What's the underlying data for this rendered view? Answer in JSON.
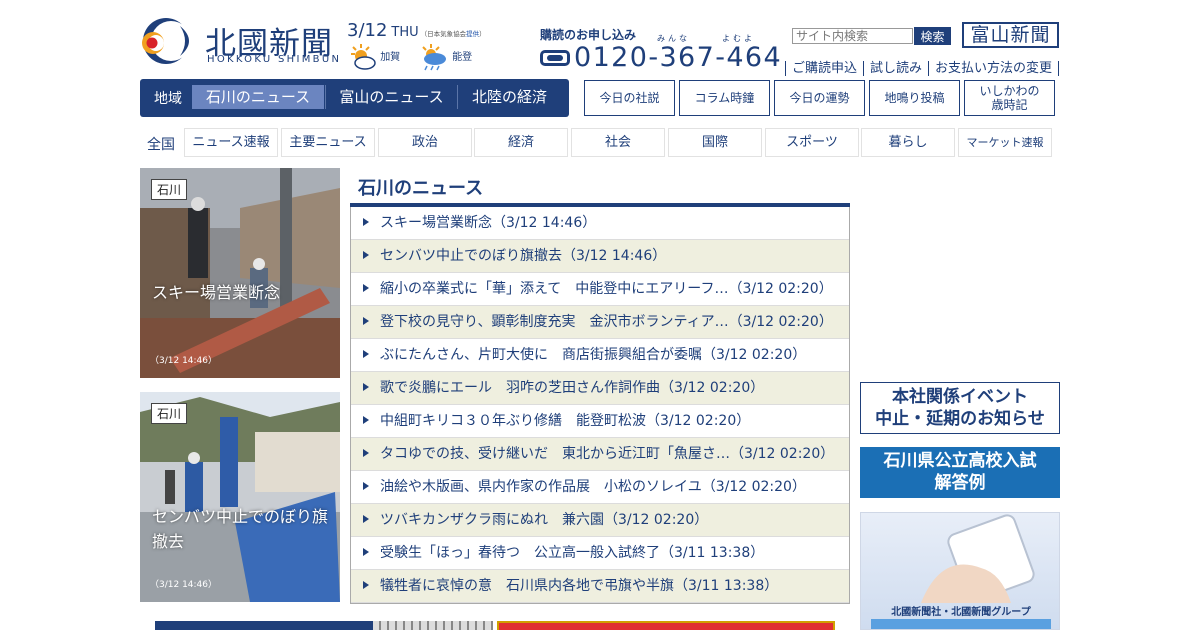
{
  "header": {
    "logo_title": "北國新聞",
    "logo_sub": "HOKKOKU SHIMBUN",
    "date": "3/12",
    "dow": "THU",
    "weather_source_prefix": "（日本気象協会",
    "weather_source_link": "提供",
    "weather_source_suffix": "）",
    "weather": [
      {
        "place": "加賀",
        "icon": "sun-cloud-icon"
      },
      {
        "place": "能登",
        "icon": "sun-rain-icon"
      }
    ],
    "subscribe_label": "購読のお申し込み",
    "phone_ruby_1": "みんな",
    "phone_ruby_2": "よむよ",
    "phone": "0120-367-464",
    "search_placeholder": "サイト内検索",
    "search_button": "検索",
    "toyama_logo": "富山新聞",
    "sub_links": [
      "ご購読申込",
      "試し読み",
      "お支払い方法の変更"
    ]
  },
  "region_nav": {
    "label": "地域",
    "tabs": [
      "石川のニュース",
      "富山のニュース",
      "北陸の経済"
    ],
    "active_index": 0
  },
  "feature_buttons": [
    "今日の社説",
    "コラム時鐘",
    "今日の運勢",
    "地鳴り投稿",
    "いしかわの\n歳時記"
  ],
  "categories": {
    "all_label": "全国",
    "tabs": [
      "ニュース速報",
      "主要ニュース",
      "政治",
      "経済",
      "社会",
      "国際",
      "スポーツ",
      "暮らし",
      "マーケット速報"
    ]
  },
  "photos": [
    {
      "badge": "石川",
      "caption": "スキー場営業断念",
      "time": "（3/12 14:46）"
    },
    {
      "badge": "石川",
      "caption": "センバツ中止でのぼり旗撤去",
      "time": "（3/12 14:46）"
    }
  ],
  "news": {
    "title": "石川のニュース",
    "items": [
      "スキー場営業断念（3/12 14:46）",
      "センバツ中止でのぼり旗撤去（3/12 14:46）",
      "縮小の卒業式に「華」添えて　中能登中にエアリーフ…（3/12 02:20）",
      "登下校の見守り、顕彰制度充実　金沢市ボランティア…（3/12 02:20）",
      "ぶにたんさん、片町大使に　商店街振興組合が委嘱（3/12 02:20）",
      "歌で炎鵬にエール　羽咋の芝田さん作詞作曲（3/12 02:20）",
      "中組町キリコ３０年ぶり修繕　能登町松波（3/12 02:20）",
      "タコゆでの技、受け継いだ　東北から近江町「魚屋さ…（3/12 02:20）",
      "油絵や木版画、県内作家の作品展　小松のソレイユ（3/12 02:20）",
      "ツバキカンザクラ雨にぬれ　兼六園（3/12 02:20）",
      "受験生「ほっ」春待つ　公立高一般入試終了（3/11 13:38）",
      "犠牲者に哀悼の意　石川県内各地で弔旗や半旗（3/11 13:38）"
    ]
  },
  "banners": {
    "event_line1": "本社関係イベント",
    "event_line2": "中止・延期のお知らせ",
    "exam_line1": "石川県公立高校入試",
    "exam_line2": "解答例",
    "ad_text": "北國新聞社・北國新聞グループ"
  },
  "colors": {
    "brand_navy": "#1f3f7a",
    "active_tab": "#6b85c0",
    "row_alt": "#efefdf",
    "exam_banner": "#1b6fb5"
  }
}
